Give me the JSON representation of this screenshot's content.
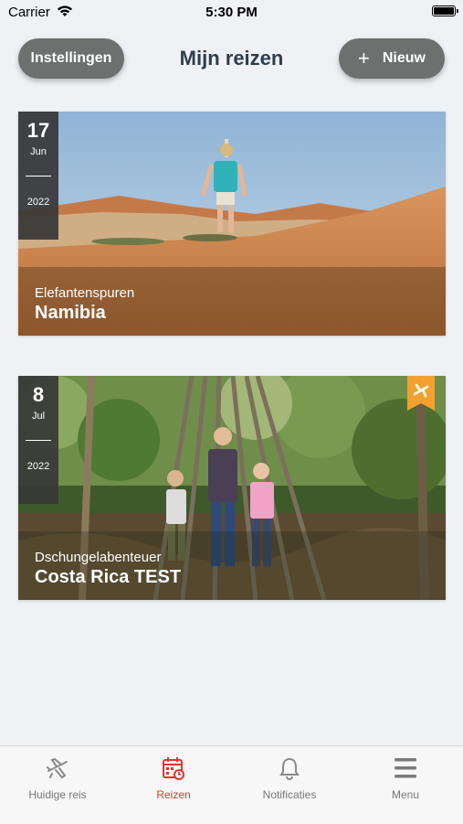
{
  "status_bar": {
    "carrier": "Carrier",
    "time": "5:30 PM"
  },
  "header": {
    "settings_label": "Instellingen",
    "title": "Mijn reizen",
    "new_label": "Nieuw"
  },
  "trips": [
    {
      "day": "17",
      "month": "Jun",
      "year": "2022",
      "subtitle": "Elefantenspuren",
      "title": "Namibia",
      "flight_badge": false
    },
    {
      "day": "8",
      "month": "Jul",
      "year": "2022",
      "subtitle": "Dschungelabenteuer",
      "title": "Costa Rica TEST",
      "flight_badge": true
    }
  ],
  "tab_bar": {
    "items": [
      {
        "label": "Huidige reis",
        "icon": "airplane-icon",
        "active": false
      },
      {
        "label": "Reizen",
        "icon": "calendar-icon",
        "active": true
      },
      {
        "label": "Notificaties",
        "icon": "bell-icon",
        "active": false
      },
      {
        "label": "Menu",
        "icon": "hamburger-icon",
        "active": false
      }
    ]
  },
  "colors": {
    "accent": "#e3342f",
    "button_bg": "#6c706e",
    "title": "#2c3e50",
    "badge_orange": "#f2a12f"
  }
}
